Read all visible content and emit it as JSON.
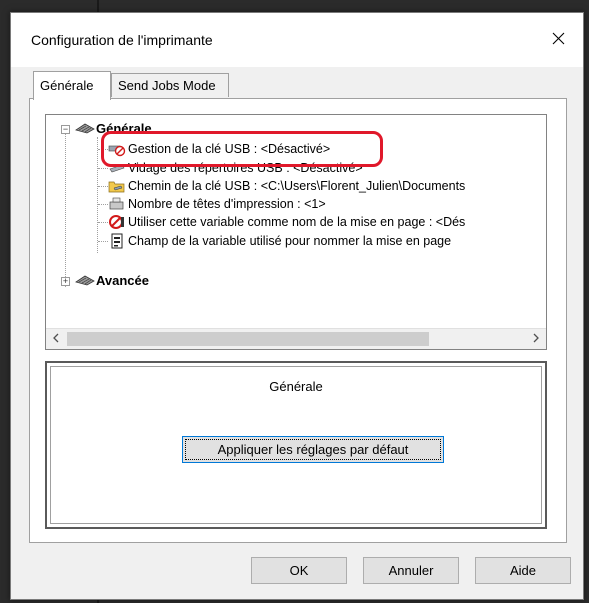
{
  "window": {
    "title": "Configuration de l'imprimante"
  },
  "tabs": [
    {
      "label": "Générale",
      "active": true
    },
    {
      "label": "Send Jobs Mode",
      "active": false
    }
  ],
  "tree": {
    "groups": [
      {
        "label": "Générale",
        "expanded": true,
        "icon": "printer-head-icon",
        "items": [
          {
            "label": "Gestion de la clé USB : <Désactivé>",
            "icon": "usb-disabled-icon",
            "highlighted": true
          },
          {
            "label": "Vidage des répertoires USB : <Désactivé>",
            "icon": "usb-icon"
          },
          {
            "label": "Chemin de la clé USB : <C:\\Users\\Florent_Julien\\Documents",
            "icon": "folder-usb-icon"
          },
          {
            "label": "Nombre de têtes d'impression : <1>",
            "icon": "print-heads-icon"
          },
          {
            "label": "Utiliser cette variable comme nom de la mise en page : <Dés",
            "icon": "forbidden-icon"
          },
          {
            "label": "Champ de la variable utilisé pour nommer la mise en page",
            "icon": "variable-field-icon"
          }
        ]
      },
      {
        "label": "Avancée",
        "expanded": false,
        "icon": "printer-head-icon"
      }
    ],
    "highlight_color": "#e0182a"
  },
  "info_panel": {
    "title": "Générale",
    "default_button": "Appliquer les réglages par défaut"
  },
  "buttons": {
    "ok": "OK",
    "cancel": "Annuler",
    "help": "Aide"
  },
  "colors": {
    "focus_border": "#0078d7",
    "dialog_bg": "#f0f0f0"
  }
}
